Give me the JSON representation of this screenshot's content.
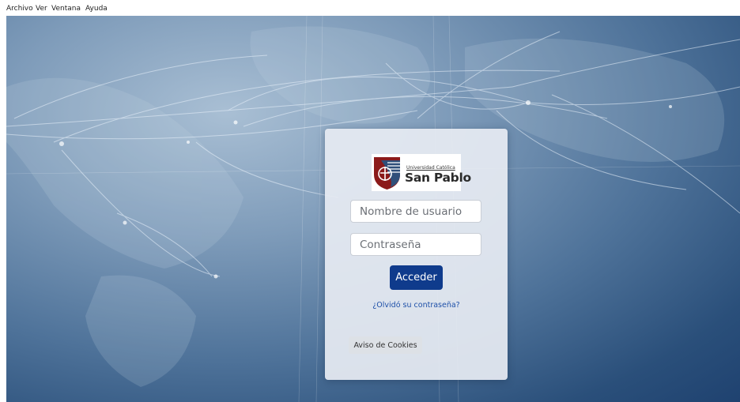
{
  "menubar": {
    "items": [
      {
        "label": "Archivo"
      },
      {
        "label": "Ver"
      },
      {
        "label": "Ventana"
      },
      {
        "label": "Ayuda"
      }
    ]
  },
  "login": {
    "logo": {
      "small_text": "Universidad Católica",
      "big_text": "San Pablo",
      "brand_color": "#8b1a1a"
    },
    "username": {
      "placeholder": "Nombre de usuario",
      "value": ""
    },
    "password": {
      "placeholder": "Contraseña",
      "value": ""
    },
    "submit_label": "Acceder",
    "forgot_label": "¿Olvidó su contraseña?",
    "cookies_label": "Aviso de Cookies"
  },
  "colors": {
    "primary_button": "#0f3b8c",
    "link": "#1d4fa8",
    "background_dark": "#1f4270",
    "background_light": "#a9bfd4"
  }
}
